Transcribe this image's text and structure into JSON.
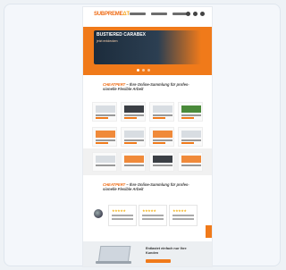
{
  "header": {
    "logo_main": "SUBPREME",
    "logo_accent": "ΔT",
    "nav_items": [
      "",
      "",
      ""
    ]
  },
  "hero": {
    "title": "BUSTIERED CARABEX",
    "subtitle": "jetzt entdecken"
  },
  "sections": [
    {
      "lead": "CHEATPERT",
      "rest": " – Ihre Online-Sammlung für profes-sionelle Flexible Arbeit"
    },
    {
      "lead": "CHEATPERT",
      "rest": " – Ihre Online-Sammlung für profes-sionelle Flexible Arbeit"
    }
  ],
  "reviews": {
    "stars": "★★★★★"
  },
  "bottom": {
    "text": "Entlastet einfach nur Ihre Kunden"
  },
  "colors": {
    "brand": "#f07a1a",
    "dark": "#2c3f52"
  }
}
